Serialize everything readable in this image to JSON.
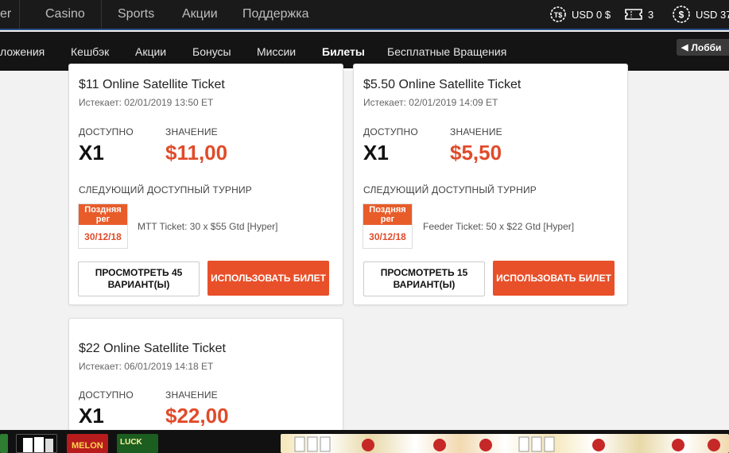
{
  "topnav": {
    "items": [
      "er",
      "Casino",
      "Sports",
      "Акции",
      "Поддержка"
    ]
  },
  "wallet": {
    "tickets_currency": "USD 0 $",
    "ticket_count": "3",
    "balance": "USD 37"
  },
  "subnav": {
    "items": [
      "ложения",
      "Кешбэк",
      "Акции",
      "Бонусы",
      "Миссии",
      "Билеты",
      "Бесплатные Вращения"
    ],
    "active": "Билеты",
    "lobby_label": "Лобби"
  },
  "labels": {
    "available": "ДОСТУПНО",
    "value": "ЗНАЧЕНИЕ",
    "next_tournament": "СЛЕДУЮЩИЙ ДОСТУПНЫЙ ТУРНИР",
    "use_ticket": "ИСПОЛЬЗОВАТЬ БИЛЕТ"
  },
  "tickets": [
    {
      "title": "$11 Online Satellite Ticket",
      "expires": "Истекает: 02/01/2019   13:50 ET",
      "count": "X1",
      "value": "$11,00",
      "badge": "Поздняя рег",
      "date": "30/12/18",
      "tournament": "MTT Ticket: 30 x $55 Gtd [Hyper]",
      "view_label": "ПРОСМОТРЕТЬ 45 ВАРИАНТ(Ы)"
    },
    {
      "title": "$5.50 Online Satellite Ticket",
      "expires": "Истекает: 02/01/2019   14:09 ET",
      "count": "X1",
      "value": "$5,50",
      "badge": "Поздняя рег",
      "date": "30/12/18",
      "tournament": "Feeder Ticket: 50 x $22 Gtd [Hyper]",
      "view_label": "ПРОСМОТРЕТЬ 15 ВАРИАНТ(Ы)"
    },
    {
      "title": "$22 Online Satellite Ticket",
      "expires": "Истекает: 06/01/2019   14:18 ET",
      "count": "X1",
      "value": "$22,00"
    }
  ],
  "colors": {
    "accent": "#e8502a",
    "value_text": "#e04b2a",
    "topbar": "#1a1a1a",
    "subnav": "#141414"
  },
  "games_strip": {
    "visible_texts": [
      "MELON",
      "LUCK"
    ]
  }
}
